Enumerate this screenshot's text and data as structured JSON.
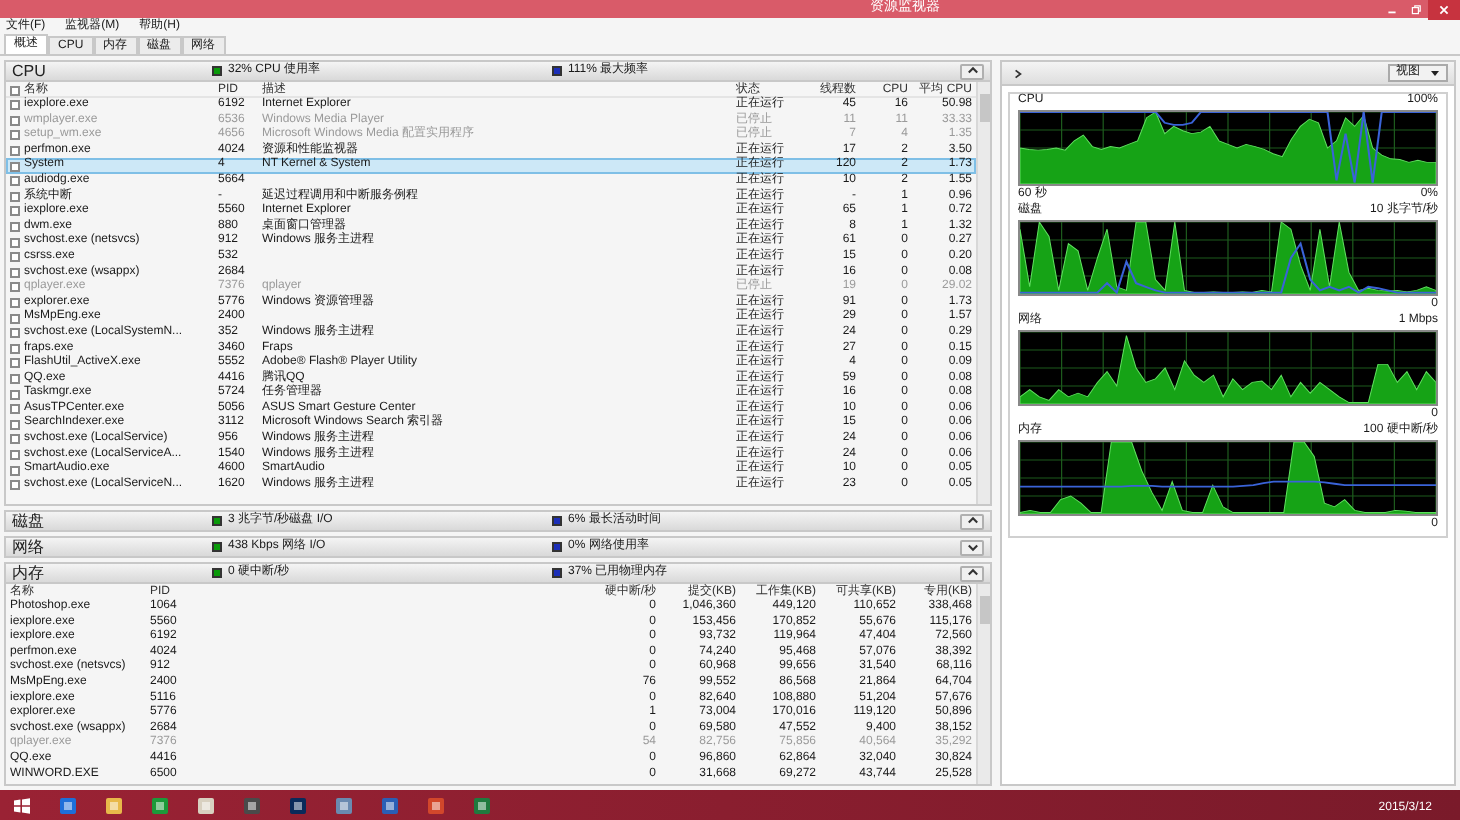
{
  "window": {
    "title": "资源监视器"
  },
  "menu": [
    "文件(F)",
    "监视器(M)",
    "帮助(H)"
  ],
  "tabs": [
    {
      "label": "概述",
      "selected": true
    },
    {
      "label": "CPU",
      "selected": false
    },
    {
      "label": "内存",
      "selected": false
    },
    {
      "label": "磁盘",
      "selected": false
    },
    {
      "label": "网络",
      "selected": false
    }
  ],
  "cpu": {
    "title": "CPU",
    "stat_1": "32% CPU 使用率",
    "stat_2": "111% 最大频率",
    "chevron_up": true,
    "all_checked": false,
    "columns": [
      "名称",
      "PID",
      "描述",
      "状态",
      "线程数",
      "CPU",
      "平均 CPU"
    ],
    "rows": [
      {
        "name": "iexplore.exe",
        "pid": "6192",
        "description": "Internet Explorer",
        "status": "正在运行",
        "threads": "45",
        "cpu": "16",
        "avg_cpu": "50.98",
        "checked": false,
        "selected": false,
        "stopped": false
      },
      {
        "name": "wmplayer.exe",
        "pid": "6536",
        "description": "Windows Media Player",
        "status": "已停止",
        "threads": "11",
        "cpu": "11",
        "avg_cpu": "33.33",
        "checked": false,
        "selected": false,
        "stopped": true
      },
      {
        "name": "setup_wm.exe",
        "pid": "4656",
        "description": "Microsoft Windows Media 配置实用程序",
        "status": "已停止",
        "threads": "7",
        "cpu": "4",
        "avg_cpu": "1.35",
        "checked": false,
        "selected": false,
        "stopped": true
      },
      {
        "name": "perfmon.exe",
        "pid": "4024",
        "description": "资源和性能监视器",
        "status": "正在运行",
        "threads": "17",
        "cpu": "2",
        "avg_cpu": "3.50",
        "checked": false,
        "selected": false,
        "stopped": false
      },
      {
        "name": "System",
        "pid": "4",
        "description": "NT Kernel & System",
        "status": "正在运行",
        "threads": "120",
        "cpu": "2",
        "avg_cpu": "1.73",
        "checked": false,
        "selected": true,
        "stopped": false
      },
      {
        "name": "audiodg.exe",
        "pid": "5664",
        "status": "正在运行",
        "threads": "10",
        "cpu": "2",
        "avg_cpu": "1.55",
        "checked": false,
        "selected": false,
        "stopped": false
      },
      {
        "name": "系统中断",
        "pid": "-",
        "description": "延迟过程调用和中断服务例程",
        "status": "正在运行",
        "threads": "-",
        "cpu": "1",
        "avg_cpu": "0.96",
        "checked": false,
        "selected": false,
        "stopped": false
      },
      {
        "name": "iexplore.exe",
        "pid": "5560",
        "description": "Internet Explorer",
        "status": "正在运行",
        "threads": "65",
        "cpu": "1",
        "avg_cpu": "0.72",
        "checked": false,
        "selected": false,
        "stopped": false
      },
      {
        "name": "dwm.exe",
        "pid": "880",
        "description": "桌面窗口管理器",
        "status": "正在运行",
        "threads": "8",
        "cpu": "1",
        "avg_cpu": "1.32",
        "checked": false,
        "selected": false,
        "stopped": false
      },
      {
        "name": "svchost.exe (netsvcs)",
        "pid": "912",
        "description": "Windows 服务主进程",
        "status": "正在运行",
        "threads": "61",
        "cpu": "0",
        "avg_cpu": "0.27",
        "checked": false,
        "selected": false,
        "stopped": false
      },
      {
        "name": "csrss.exe",
        "pid": "532",
        "status": "正在运行",
        "threads": "15",
        "cpu": "0",
        "avg_cpu": "0.20",
        "checked": false,
        "selected": false,
        "stopped": false
      },
      {
        "name": "svchost.exe (wsappx)",
        "pid": "2684",
        "status": "正在运行",
        "threads": "16",
        "cpu": "0",
        "avg_cpu": "0.08",
        "checked": false,
        "selected": false,
        "stopped": false
      },
      {
        "name": "qplayer.exe",
        "pid": "7376",
        "description": "qplayer",
        "status": "已停止",
        "threads": "19",
        "cpu": "0",
        "avg_cpu": "29.02",
        "checked": false,
        "selected": false,
        "stopped": true
      },
      {
        "name": "explorer.exe",
        "pid": "5776",
        "description": "Windows 资源管理器",
        "status": "正在运行",
        "threads": "91",
        "cpu": "0",
        "avg_cpu": "1.73",
        "checked": false,
        "selected": false,
        "stopped": false
      },
      {
        "name": "MsMpEng.exe",
        "pid": "2400",
        "status": "正在运行",
        "threads": "29",
        "cpu": "0",
        "avg_cpu": "1.57",
        "checked": false,
        "selected": false,
        "stopped": false
      },
      {
        "name": "svchost.exe (LocalSystemN...",
        "pid": "352",
        "description": "Windows 服务主进程",
        "status": "正在运行",
        "threads": "24",
        "cpu": "0",
        "avg_cpu": "0.29",
        "checked": false,
        "selected": false,
        "stopped": false
      },
      {
        "name": "fraps.exe",
        "pid": "3460",
        "description": "Fraps",
        "status": "正在运行",
        "threads": "27",
        "cpu": "0",
        "avg_cpu": "0.15",
        "checked": false,
        "selected": false,
        "stopped": false
      },
      {
        "name": "FlashUtil_ActiveX.exe",
        "pid": "5552",
        "description": "Adobe® Flash® Player Utility",
        "status": "正在运行",
        "threads": "4",
        "cpu": "0",
        "avg_cpu": "0.09",
        "checked": false,
        "selected": false,
        "stopped": false
      },
      {
        "name": "QQ.exe",
        "pid": "4416",
        "description": "腾讯QQ",
        "status": "正在运行",
        "threads": "59",
        "cpu": "0",
        "avg_cpu": "0.08",
        "checked": false,
        "selected": false,
        "stopped": false
      },
      {
        "name": "Taskmgr.exe",
        "pid": "5724",
        "description": "任务管理器",
        "status": "正在运行",
        "threads": "16",
        "cpu": "0",
        "avg_cpu": "0.08",
        "checked": false,
        "selected": false,
        "stopped": false
      },
      {
        "name": "AsusTPCenter.exe",
        "pid": "5056",
        "description": "ASUS Smart Gesture Center",
        "status": "正在运行",
        "threads": "10",
        "cpu": "0",
        "avg_cpu": "0.06",
        "checked": false,
        "selected": false,
        "stopped": false
      },
      {
        "name": "SearchIndexer.exe",
        "pid": "3112",
        "description": "Microsoft Windows Search 索引器",
        "status": "正在运行",
        "threads": "15",
        "cpu": "0",
        "avg_cpu": "0.06",
        "checked": false,
        "selected": false,
        "stopped": false
      },
      {
        "name": "svchost.exe (LocalService)",
        "pid": "956",
        "description": "Windows 服务主进程",
        "status": "正在运行",
        "threads": "24",
        "cpu": "0",
        "avg_cpu": "0.06",
        "checked": false,
        "selected": false,
        "stopped": false
      },
      {
        "name": "svchost.exe (LocalServiceA...",
        "pid": "1540",
        "description": "Windows 服务主进程",
        "status": "正在运行",
        "threads": "24",
        "cpu": "0",
        "avg_cpu": "0.06",
        "checked": false,
        "selected": false,
        "stopped": false
      },
      {
        "name": "SmartAudio.exe",
        "pid": "4600",
        "description": "SmartAudio",
        "status": "正在运行",
        "threads": "10",
        "cpu": "0",
        "avg_cpu": "0.05",
        "checked": false,
        "selected": false,
        "stopped": false
      },
      {
        "name": "svchost.exe (LocalServiceN...",
        "pid": "1620",
        "description": "Windows 服务主进程",
        "status": "正在运行",
        "threads": "23",
        "cpu": "0",
        "avg_cpu": "0.05",
        "checked": false,
        "selected": false,
        "stopped": false
      }
    ]
  },
  "disk": {
    "title": "磁盘",
    "stat_1": "3 兆字节/秒磁盘 I/O",
    "stat_2": "6% 最长活动时间",
    "chevron_up": true
  },
  "network": {
    "title": "网络",
    "stat_1": "438 Kbps 网络 I/O",
    "stat_2": "0% 网络使用率",
    "chevron_up": false
  },
  "memory": {
    "title": "内存",
    "stat_1": "0 硬中断/秒",
    "stat_2": "37% 已用物理内存",
    "chevron_up": true,
    "columns": [
      "名称",
      "PID",
      "硬中断/秒",
      "提交(KB)",
      "工作集(KB)",
      "可共享(KB)",
      "专用(KB)"
    ],
    "rows": [
      {
        "name": "Photoshop.exe",
        "pid": "1064",
        "hard_faults": "0",
        "commit": "1,046,360",
        "working_set": "449,120",
        "shareable": "110,652",
        "private": "338,468",
        "stopped": false
      },
      {
        "name": "iexplore.exe",
        "pid": "5560",
        "hard_faults": "0",
        "commit": "153,456",
        "working_set": "170,852",
        "shareable": "55,676",
        "private": "115,176",
        "stopped": false
      },
      {
        "name": "iexplore.exe",
        "pid": "6192",
        "hard_faults": "0",
        "commit": "93,732",
        "working_set": "119,964",
        "shareable": "47,404",
        "private": "72,560",
        "stopped": false
      },
      {
        "name": "perfmon.exe",
        "pid": "4024",
        "hard_faults": "0",
        "commit": "74,240",
        "working_set": "95,468",
        "shareable": "57,076",
        "private": "38,392",
        "stopped": false
      },
      {
        "name": "svchost.exe (netsvcs)",
        "pid": "912",
        "hard_faults": "0",
        "commit": "60,968",
        "working_set": "99,656",
        "shareable": "31,540",
        "private": "68,116",
        "stopped": false
      },
      {
        "name": "MsMpEng.exe",
        "pid": "2400",
        "hard_faults": "76",
        "commit": "99,552",
        "working_set": "86,568",
        "shareable": "21,864",
        "private": "64,704",
        "stopped": false
      },
      {
        "name": "iexplore.exe",
        "pid": "5116",
        "hard_faults": "0",
        "commit": "82,640",
        "working_set": "108,880",
        "shareable": "51,204",
        "private": "57,676",
        "stopped": false
      },
      {
        "name": "explorer.exe",
        "pid": "5776",
        "hard_faults": "1",
        "commit": "73,004",
        "working_set": "170,016",
        "shareable": "119,120",
        "private": "50,896",
        "stopped": false
      },
      {
        "name": "svchost.exe (wsappx)",
        "pid": "2684",
        "hard_faults": "0",
        "commit": "69,580",
        "working_set": "47,552",
        "shareable": "9,400",
        "private": "38,152",
        "stopped": false
      },
      {
        "name": "qplayer.exe",
        "pid": "7376",
        "hard_faults": "54",
        "commit": "82,756",
        "working_set": "75,856",
        "shareable": "40,564",
        "private": "35,292",
        "stopped": true
      },
      {
        "name": "QQ.exe",
        "pid": "4416",
        "hard_faults": "0",
        "commit": "96,860",
        "working_set": "62,864",
        "shareable": "32,040",
        "private": "30,824",
        "stopped": false
      },
      {
        "name": "WINWORD.EXE",
        "pid": "6500",
        "hard_faults": "0",
        "commit": "31,668",
        "working_set": "69,272",
        "shareable": "43,744",
        "private": "25,528",
        "stopped": false
      }
    ]
  },
  "view_button": "视图",
  "graphs": [
    {
      "title": "CPU",
      "max": "100%",
      "span": "60 秒",
      "min": "0%"
    },
    {
      "title": "磁盘",
      "max": "10 兆字节/秒",
      "min": "0"
    },
    {
      "title": "网络",
      "max": "1 Mbps",
      "min": "0"
    },
    {
      "title": "内存",
      "max": "100 硬中断/秒",
      "min": "0"
    }
  ],
  "taskbar": {
    "date": "2015/3/12"
  }
}
